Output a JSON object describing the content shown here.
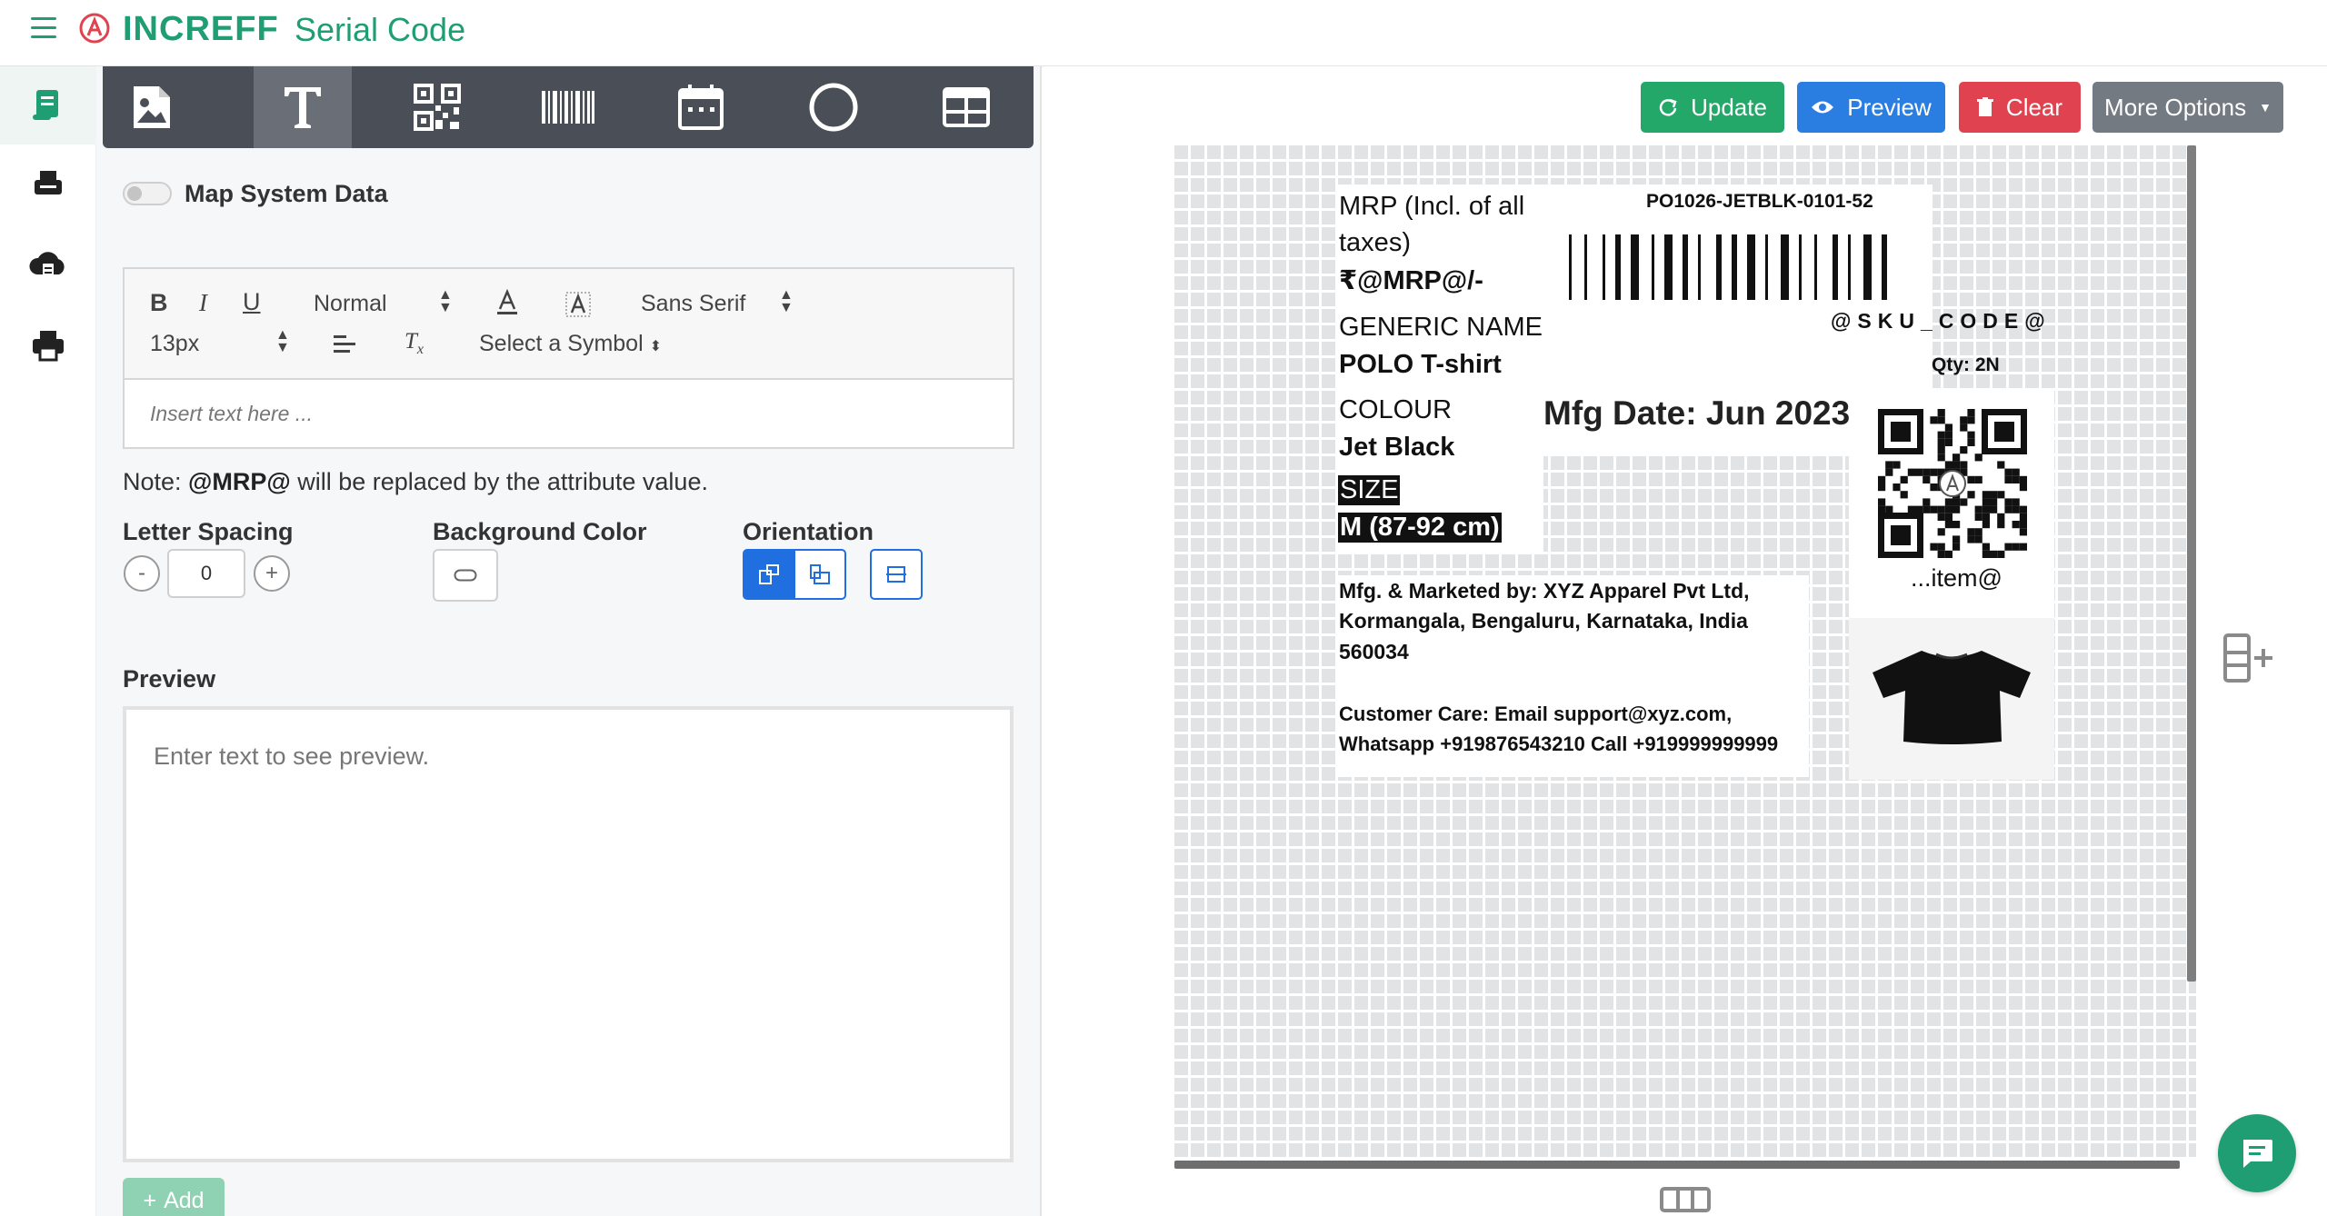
{
  "app": {
    "brand": "INCREFF",
    "title": "Serial Code"
  },
  "rail": {
    "items": [
      "label-design",
      "printer-tray",
      "cloud-upload",
      "print"
    ]
  },
  "tools": [
    "image",
    "text",
    "qr-code",
    "barcode",
    "date",
    "shape",
    "table"
  ],
  "map_system_data": {
    "label": "Map System Data",
    "checked": false
  },
  "editor": {
    "font_size_style": "Normal",
    "font_family": "Sans Serif",
    "font_px": "13px",
    "symbol_select": "Select a Symbol",
    "placeholder": "Insert text here ..."
  },
  "note": {
    "prefix": "Note: ",
    "token": "@MRP@",
    "suffix": " will be replaced by the attribute value."
  },
  "letter_spacing": {
    "label": "Letter Spacing",
    "value": "0",
    "minus": "-",
    "plus": "+"
  },
  "background_color": {
    "label": "Background Color"
  },
  "orientation": {
    "label": "Orientation"
  },
  "preview": {
    "label": "Preview",
    "placeholder": "Enter text to see preview."
  },
  "add_button": {
    "label": "Add",
    "icon": "+"
  },
  "actions": {
    "update": "Update",
    "preview": "Preview",
    "clear": "Clear",
    "more": "More Options"
  },
  "label": {
    "mrp_line1": "MRP (Incl. of all",
    "mrp_line2": "taxes)",
    "mrp_value": "₹@MRP@/-",
    "generic_name_label": "GENERIC NAME",
    "generic_name_value": "POLO T-shirt",
    "colour_label": "COLOUR",
    "colour_value": "Jet Black",
    "size_label": "SIZE",
    "size_value": "M (87-92 cm)",
    "po_code": "PO1026-JETBLK-0101-52",
    "sku_code": "@SKU_CODE@",
    "qty": "Qty: 2N",
    "mfg_date": "Mfg Date: Jun 2023",
    "item_token": "...item@",
    "mfg_line1": "Mfg. & Marketed by: XYZ Apparel Pvt Ltd,",
    "mfg_line2": "Kormangala, Bengaluru, Karnataka, India",
    "mfg_line3": "560034",
    "care_line1": "Customer Care: Email support@xyz.com,",
    "care_line2": "Whatsapp +919876543210 Call +919999999999"
  },
  "colors": {
    "brand": "#1e9e72",
    "update": "#23a869",
    "preview": "#2a7de1",
    "clear": "#e0434f",
    "more": "#737a82",
    "toolbar": "#4a4f57"
  }
}
